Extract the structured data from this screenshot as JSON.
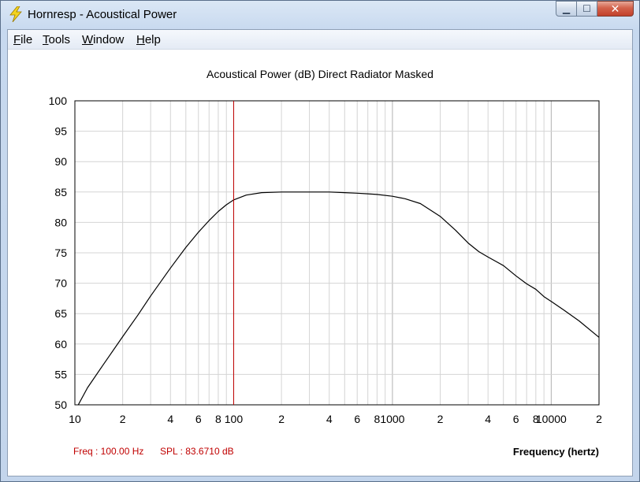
{
  "window": {
    "title": "Hornresp - Acoustical Power"
  },
  "menu": [
    {
      "mnemonic": "F",
      "rest": "ile"
    },
    {
      "mnemonic": "T",
      "rest": "ools"
    },
    {
      "mnemonic": "W",
      "rest": "indow"
    },
    {
      "mnemonic": "H",
      "rest": "elp"
    }
  ],
  "readout": {
    "freq": "Freq : 100.00 Hz",
    "spl": "SPL : 83.6710 dB"
  },
  "colors": {
    "curve": "#000000",
    "cursor": "#c00000",
    "grid": "#d4d4d4",
    "grid_decade": "#b0b0b0"
  },
  "chart_data": {
    "type": "line",
    "title": "Acoustical Power (dB)   Direct Radiator   Masked",
    "xlabel": "Frequency (hertz)",
    "ylabel": "",
    "xscale": "log",
    "xlim": [
      10,
      20000
    ],
    "ylim": [
      50,
      100
    ],
    "yticks": [
      100,
      95,
      90,
      85,
      80,
      75,
      70,
      65,
      60,
      55,
      50
    ],
    "xtick_labels": [
      {
        "value": 10,
        "label": "10"
      },
      {
        "value": 20,
        "label": "2"
      },
      {
        "value": 40,
        "label": "4"
      },
      {
        "value": 60,
        "label": "6"
      },
      {
        "value": 80,
        "label": "8"
      },
      {
        "value": 100,
        "label": "100"
      },
      {
        "value": 200,
        "label": "2"
      },
      {
        "value": 400,
        "label": "4"
      },
      {
        "value": 600,
        "label": "6"
      },
      {
        "value": 800,
        "label": "8"
      },
      {
        "value": 1000,
        "label": "1000"
      },
      {
        "value": 2000,
        "label": "2"
      },
      {
        "value": 4000,
        "label": "4"
      },
      {
        "value": 6000,
        "label": "6"
      },
      {
        "value": 8000,
        "label": "8"
      },
      {
        "value": 10000,
        "label": "10000"
      },
      {
        "value": 20000,
        "label": "2"
      }
    ],
    "grid": true,
    "cursor_x": 100,
    "series": [
      {
        "x": [
          10.5,
          12,
          15,
          20,
          25,
          30,
          40,
          50,
          60,
          70,
          80,
          90,
          100,
          120,
          150,
          200,
          300,
          400,
          500,
          600,
          700,
          800,
          1000,
          1200,
          1500,
          2000,
          2500,
          3000,
          3500,
          4000,
          5000,
          6000,
          7000,
          8000,
          9000,
          10000,
          12000,
          15000,
          20000
        ],
        "y": [
          50,
          52.8,
          56.5,
          61.2,
          64.8,
          67.9,
          72.5,
          75.9,
          78.4,
          80.3,
          81.8,
          82.9,
          83.7,
          84.5,
          84.9,
          85.0,
          85.0,
          85.0,
          84.9,
          84.8,
          84.7,
          84.6,
          84.3,
          83.9,
          83.1,
          81.0,
          78.7,
          76.6,
          75.2,
          74.3,
          72.9,
          71.2,
          69.9,
          69.0,
          67.8,
          67.0,
          65.6,
          63.8,
          61.1
        ]
      }
    ]
  }
}
